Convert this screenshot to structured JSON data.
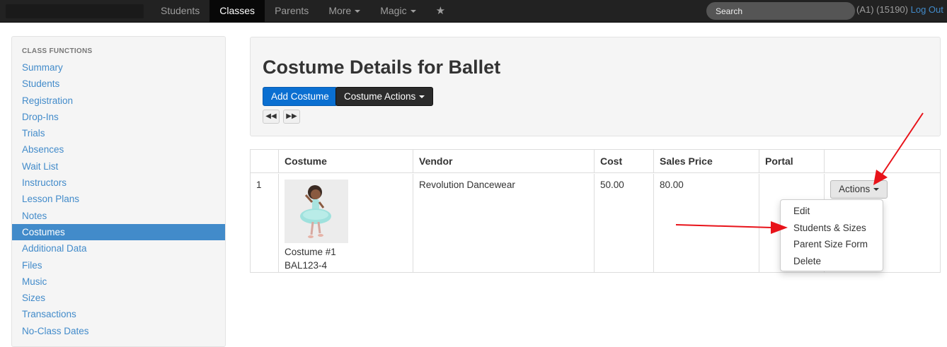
{
  "nav": {
    "items": [
      {
        "label": "Students",
        "active": false,
        "caret": false
      },
      {
        "label": "Classes",
        "active": true,
        "caret": false
      },
      {
        "label": "Parents",
        "active": false,
        "caret": false
      },
      {
        "label": "More",
        "active": false,
        "caret": true
      },
      {
        "label": "Magic",
        "active": false,
        "caret": true
      }
    ],
    "star_icon": "star-icon",
    "search_placeholder": "Search",
    "user_info": "(A1) (15190)",
    "logout_label": "Log Out"
  },
  "sidebar": {
    "header": "CLASS FUNCTIONS",
    "items": [
      {
        "label": "Summary"
      },
      {
        "label": "Students"
      },
      {
        "label": "Registration"
      },
      {
        "label": "Drop-Ins"
      },
      {
        "label": "Trials"
      },
      {
        "label": "Absences"
      },
      {
        "label": "Wait List"
      },
      {
        "label": "Instructors"
      },
      {
        "label": "Lesson Plans"
      },
      {
        "label": "Notes"
      },
      {
        "label": "Costumes"
      },
      {
        "label": "Additional Data"
      },
      {
        "label": "Files"
      },
      {
        "label": "Music"
      },
      {
        "label": "Sizes"
      },
      {
        "label": "Transactions"
      },
      {
        "label": "No-Class Dates"
      }
    ],
    "active_index": 10
  },
  "main": {
    "title": "Costume Details for Ballet",
    "add_label": "Add Costume",
    "actions_label": "Costume Actions",
    "prev_icon": "backward-icon",
    "next_icon": "forward-icon"
  },
  "table": {
    "headers": [
      "",
      "Costume",
      "Vendor",
      "Cost",
      "Sales Price",
      "Portal",
      ""
    ],
    "rows": [
      {
        "index": "1",
        "costume_name": "Costume #1",
        "costume_code": "BAL123-4",
        "vendor": "Revolution Dancewear",
        "cost": "50.00",
        "sales_price": "80.00",
        "portal": "",
        "actions_label": "Actions"
      }
    ]
  },
  "dropdown": {
    "items": [
      "Edit",
      "Students & Sizes",
      "Parent Size Form",
      "Delete"
    ]
  },
  "colors": {
    "accent": "#428bca",
    "annotation_arrow": "#e8131a"
  }
}
